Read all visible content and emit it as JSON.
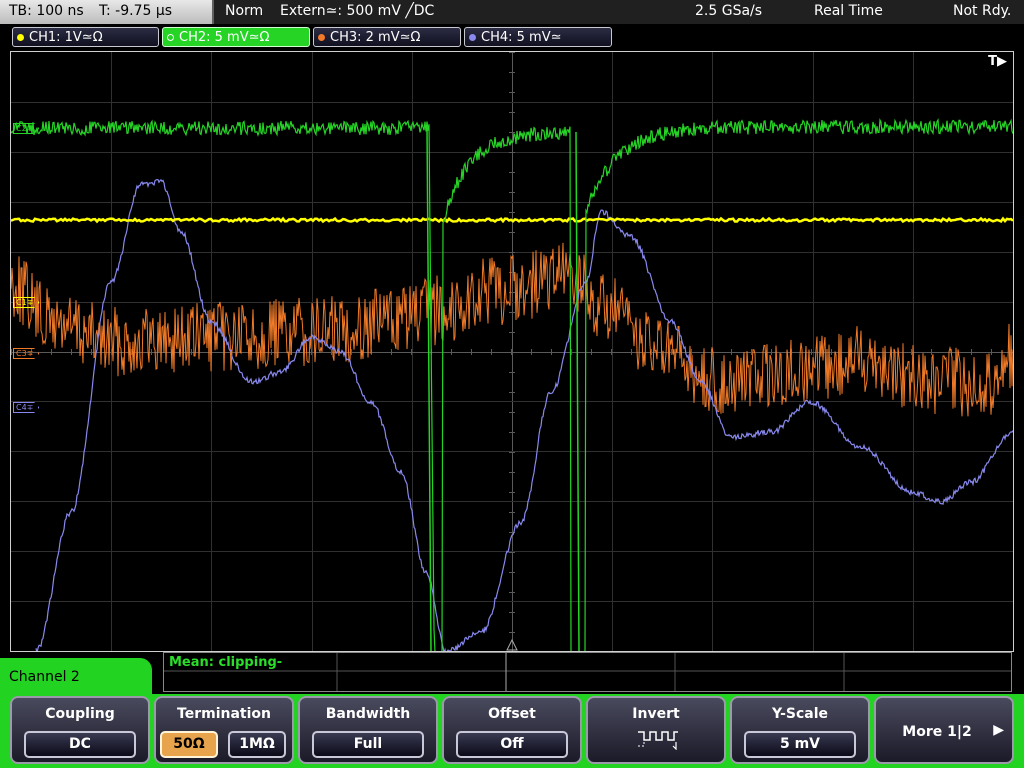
{
  "statusbar": {
    "timebase": "TB: 100 ns",
    "trigger_time": "T: -9.75 µs",
    "trigger_mode": "Norm",
    "trigger_source": "Extern≃: 500 mV ╱DC",
    "sample_rate": "2.5 GSa/s",
    "acq_mode": "Real Time",
    "status": "Not Rdy."
  },
  "channels": [
    {
      "label": "CH1: 1V≃Ω",
      "color": "#ffff00"
    },
    {
      "label": "CH2: 5 mV≃Ω",
      "color": "#26d426"
    },
    {
      "label": "CH3: 2 mV≃Ω",
      "color": "#f07a28"
    },
    {
      "label": "CH4: 5 mV≃",
      "color": "#8888ee"
    }
  ],
  "markers": {
    "c2": "C2∓",
    "c1": "C1∓",
    "c3": "C3∓",
    "c4": "C4∓"
  },
  "trigger_indicator": "T▶",
  "measurement": {
    "text": "Mean: clipping-"
  },
  "menu": {
    "title": "Channel 2",
    "coupling": {
      "title": "Coupling",
      "value": "DC"
    },
    "termination": {
      "title": "Termination",
      "options": [
        "50Ω",
        "1MΩ"
      ],
      "selected": "50Ω"
    },
    "bandwidth": {
      "title": "Bandwidth",
      "value": "Full"
    },
    "offset": {
      "title": "Offset",
      "value": "Off"
    },
    "invert": {
      "title": "Invert"
    },
    "yscale": {
      "title": "Y-Scale",
      "value": "5 mV"
    },
    "more": {
      "label": "More 1|2"
    }
  },
  "colors": {
    "ch1": "#ffff00",
    "ch2": "#26d426",
    "ch3": "#f07a28",
    "ch4": "#8888ee",
    "accent_green": "#22d322",
    "selected_option": "#e7a44c"
  }
}
